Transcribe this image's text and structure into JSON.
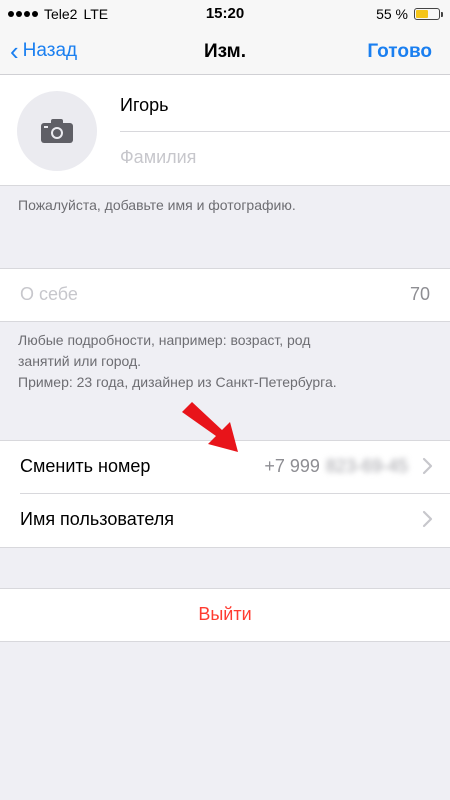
{
  "status_bar": {
    "carrier": "Tele2",
    "network": "LTE",
    "time": "15:20",
    "battery": "55 %",
    "battery_level": 0.55
  },
  "nav": {
    "back_label": "Назад",
    "title": "Изм.",
    "done_label": "Готово"
  },
  "profile": {
    "first_name": "Игорь",
    "last_name_placeholder": "Фамилия"
  },
  "hint_name": "Пожалуйста, добавьте имя и фотографию.",
  "about": {
    "placeholder": "О себе",
    "counter": "70"
  },
  "hint_about": {
    "line1": "Любые подробности, например: возраст, род",
    "line2": "занятий или город.",
    "line3": "Пример: 23 года, дизайнер из Санкт-Петербурга."
  },
  "rows": {
    "change_number": {
      "label": "Сменить номер",
      "value_visible": "+7 999",
      "value_hidden": "823-69-45"
    },
    "username": {
      "label": "Имя пользователя"
    }
  },
  "logout": {
    "label": "Выйти"
  },
  "colors": {
    "accent": "#1a7ff0",
    "destructive": "#ff3b30",
    "annotation_arrow": "#e8141a"
  }
}
